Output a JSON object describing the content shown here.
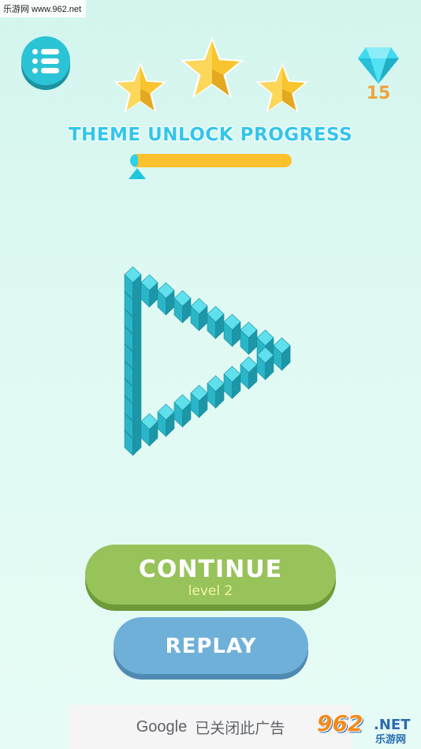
{
  "watermark": {
    "top_text": "乐游网 www.962.net",
    "bottom_brand": "962",
    "bottom_net": ".NET",
    "bottom_cn": "乐游网"
  },
  "menu": {
    "icon": "list-icon"
  },
  "stars": {
    "earned": 3,
    "total": 3,
    "color": "#f6c531"
  },
  "gems": {
    "icon": "diamond-icon",
    "count": "15",
    "color": "#3fd9f0"
  },
  "progress": {
    "title": "THEME UNLOCK PROGRESS",
    "fraction": 0.05,
    "fill_color": "#2fd2e6",
    "track_color": "#fdc12e"
  },
  "puzzle": {
    "shape": "impossible-triangle",
    "color": "#2ec3d4"
  },
  "buttons": {
    "continue_label": "CONTINUE",
    "continue_sub": "level 2",
    "replay_label": "REPLAY"
  },
  "ad": {
    "brand": "Google",
    "text": "已关闭此广告"
  }
}
